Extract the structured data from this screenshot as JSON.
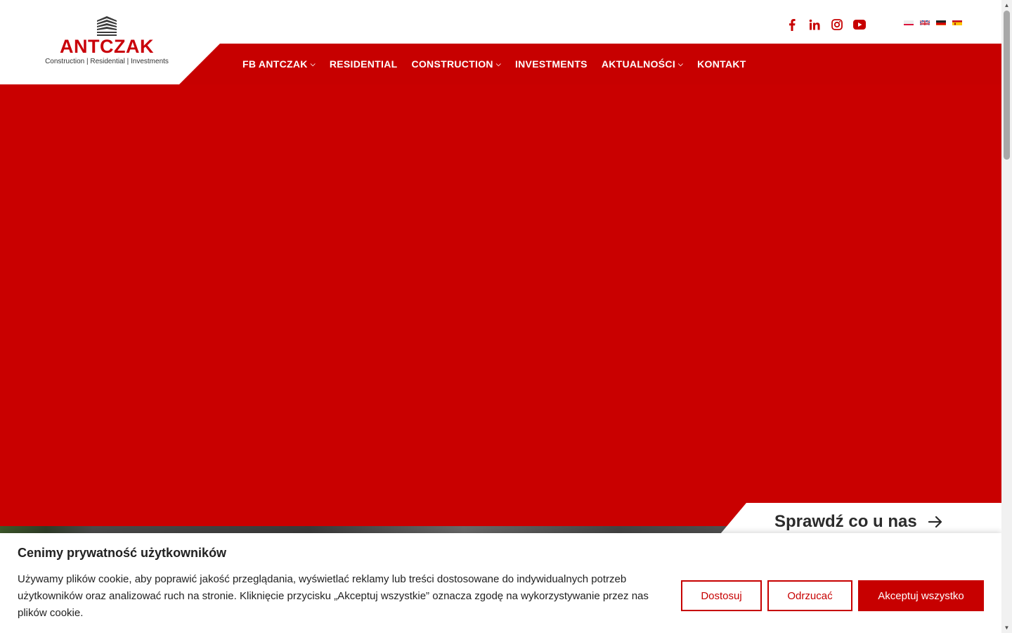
{
  "colors": {
    "brand_red": "#c70000",
    "hero_red": "#c90000",
    "text_dark": "#212121",
    "white": "#ffffff"
  },
  "logo": {
    "name": "ANTCZAK",
    "tagline": "Construction  |  Residential  |  Investments",
    "icon": "building-stripes-icon"
  },
  "nav": {
    "items": [
      {
        "label": "FB ANTCZAK",
        "has_dropdown": true
      },
      {
        "label": "RESIDENTIAL",
        "has_dropdown": false
      },
      {
        "label": "CONSTRUCTION",
        "has_dropdown": true
      },
      {
        "label": "INVESTMENTS",
        "has_dropdown": false
      },
      {
        "label": "AKTUALNOŚCI",
        "has_dropdown": true
      },
      {
        "label": "KONTAKT",
        "has_dropdown": false
      }
    ]
  },
  "socials": [
    "facebook-icon",
    "linkedin-icon",
    "instagram-icon",
    "youtube-icon"
  ],
  "languages": [
    "flag-pl-icon",
    "flag-en-icon",
    "flag-de-icon",
    "flag-es-icon"
  ],
  "hero": {
    "cta_label": "Sprawdź co u nas"
  },
  "cookie": {
    "title": "Cenimy prywatność użytkowników",
    "text": "Używamy plików cookie, aby poprawić jakość przeglądania, wyświetlać reklamy lub treści dostosowane do indywidualnych potrzeb użytkowników oraz analizować ruch na stronie. Kliknięcie przycisku „Akceptuj wszystkie” oznacza zgodę na wykorzystywanie przez nas plików cookie.",
    "customize_label": "Dostosuj",
    "reject_label": "Odrzucać",
    "accept_label": "Akceptuj wszystko"
  }
}
